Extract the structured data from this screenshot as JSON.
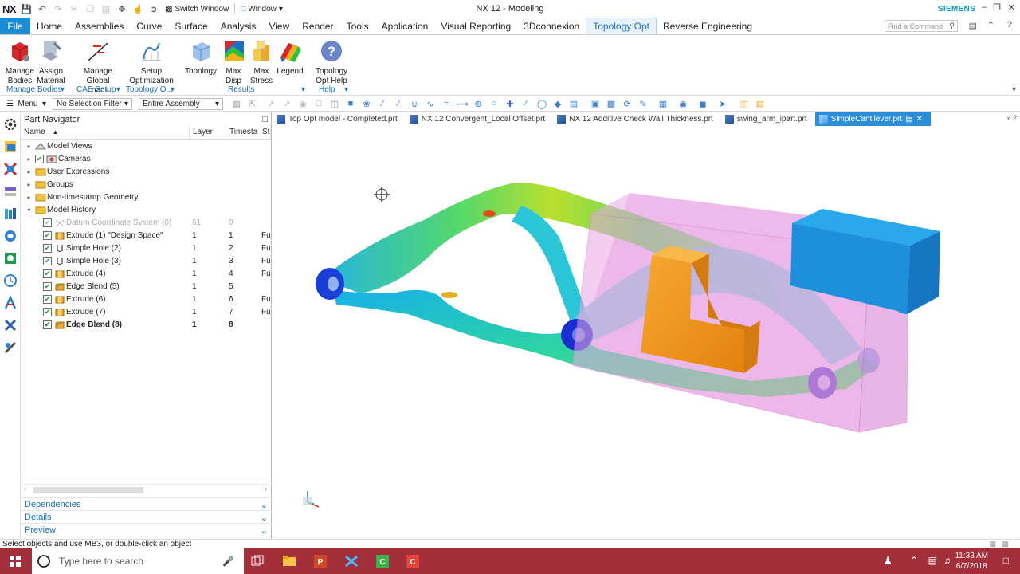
{
  "titlebar": {
    "logo": "NX",
    "switch_window": "Switch Window",
    "window": "Window",
    "title": "NX 12 - Modeling",
    "brand": "SIEMENS"
  },
  "menubar": {
    "file": "File",
    "tabs": [
      "Home",
      "Assemblies",
      "Curve",
      "Surface",
      "Analysis",
      "View",
      "Render",
      "Tools",
      "Application",
      "Visual Reporting",
      "3Dconnexion",
      "Topology Opt",
      "Reverse Engineering"
    ],
    "active_tab": "Topology Opt",
    "find_placeholder": "Find a Command"
  },
  "ribbon": {
    "buttons": [
      {
        "line1": "Manage",
        "line2": "Bodies",
        "icon": "manage-bodies-icon"
      },
      {
        "line1": "Assign",
        "line2": "Material",
        "icon": "assign-material-icon"
      },
      {
        "line1": "Manage",
        "line2": "Global Loads",
        "icon": "global-loads-icon"
      },
      {
        "line1": "Setup",
        "line2": "Optimization",
        "icon": "setup-optimization-icon"
      },
      {
        "line1": "Topology",
        "line2": "",
        "icon": "topology-icon"
      },
      {
        "line1": "Max",
        "line2": "Disp",
        "icon": "max-disp-icon"
      },
      {
        "line1": "Max",
        "line2": "Stress",
        "icon": "max-stress-icon"
      },
      {
        "line1": "Legend",
        "line2": "",
        "icon": "legend-icon"
      },
      {
        "line1": "Topology",
        "line2": "Opt Help",
        "icon": "help-icon"
      }
    ],
    "groups": [
      "Manage Bodies",
      "CAE Setup",
      "Topology O...",
      "Results",
      "Help"
    ]
  },
  "toolbar": {
    "menu": "Menu",
    "selection_filter": "No Selection Filter",
    "scope": "Entire Assembly"
  },
  "navigator": {
    "title": "Part Navigator",
    "columns": [
      "Name",
      "Layer",
      "Timesta",
      "St"
    ],
    "rows": [
      {
        "name": "Model Views",
        "layer": "",
        "ts": "",
        "st": "",
        "level": 0,
        "expander": "+",
        "check": false,
        "icon": "views-icon"
      },
      {
        "name": "Cameras",
        "layer": "",
        "ts": "",
        "st": "",
        "level": 0,
        "expander": "+",
        "check": true,
        "icon": "camera-icon"
      },
      {
        "name": "User Expressions",
        "layer": "",
        "ts": "",
        "st": "",
        "level": 0,
        "expander": "+",
        "check": false,
        "icon": "folder-icon"
      },
      {
        "name": "Groups",
        "layer": "",
        "ts": "",
        "st": "",
        "level": 0,
        "expander": "+",
        "check": false,
        "icon": "folder-icon"
      },
      {
        "name": "Non-timestamp Geometry",
        "layer": "",
        "ts": "",
        "st": "",
        "level": 0,
        "expander": "+",
        "check": false,
        "icon": "folder-icon"
      },
      {
        "name": "Model History",
        "layer": "",
        "ts": "",
        "st": "",
        "level": 0,
        "expander": "-",
        "check": false,
        "icon": "folder-icon"
      },
      {
        "name": "Datum Coordinate System (0)",
        "layer": "61",
        "ts": "0",
        "st": "",
        "level": 1,
        "expander": "",
        "check": true,
        "icon": "datum-icon",
        "grey": true
      },
      {
        "name": "Extrude (1) \"Design Space\"",
        "layer": "1",
        "ts": "1",
        "st": "Fu",
        "level": 1,
        "expander": "",
        "check": true,
        "icon": "extrude-icon"
      },
      {
        "name": "Simple Hole (2)",
        "layer": "1",
        "ts": "2",
        "st": "Fu",
        "level": 1,
        "expander": "",
        "check": true,
        "icon": "hole-icon"
      },
      {
        "name": "Simple Hole (3)",
        "layer": "1",
        "ts": "3",
        "st": "Fu",
        "level": 1,
        "expander": "",
        "check": true,
        "icon": "hole-icon"
      },
      {
        "name": "Extrude (4)",
        "layer": "1",
        "ts": "4",
        "st": "Fu",
        "level": 1,
        "expander": "",
        "check": true,
        "icon": "extrude-icon"
      },
      {
        "name": "Edge Blend (5)",
        "layer": "1",
        "ts": "5",
        "st": "",
        "level": 1,
        "expander": "",
        "check": true,
        "icon": "blend-icon"
      },
      {
        "name": "Extrude (6)",
        "layer": "1",
        "ts": "6",
        "st": "Fu",
        "level": 1,
        "expander": "",
        "check": true,
        "icon": "extrude-icon"
      },
      {
        "name": "Extrude (7)",
        "layer": "1",
        "ts": "7",
        "st": "Fu",
        "level": 1,
        "expander": "",
        "check": true,
        "icon": "extrude-icon"
      },
      {
        "name": "Edge Blend (8)",
        "layer": "1",
        "ts": "8",
        "st": "",
        "level": 1,
        "expander": "",
        "check": true,
        "icon": "blend-icon",
        "bold": true
      }
    ],
    "sections": [
      "Dependencies",
      "Details",
      "Preview"
    ]
  },
  "doctabs": {
    "tabs": [
      "Top Opt model - Completed.prt",
      "NX 12 Convergent_Local Offset.prt",
      "NX 12 Additive Check Wall Thickness.prt",
      "swing_arm_ipart.prt",
      "SimpleCantilever.prt"
    ],
    "active": "SimpleCantilever.prt",
    "overflow": "» 2"
  },
  "status": {
    "message": "Select objects and use MB3, or double-click an object"
  },
  "taskbar": {
    "search_placeholder": "Type here to search",
    "time": "11:33 AM",
    "date": "6/7/2018"
  },
  "colors": {
    "accent": "#1b8bd3",
    "taskbar": "#a32f3a",
    "brand": "#0a9bb7",
    "design_space": "#e9a6e3",
    "keep_block": "#f29a1c",
    "fixed_block": "#1d8fdc"
  }
}
